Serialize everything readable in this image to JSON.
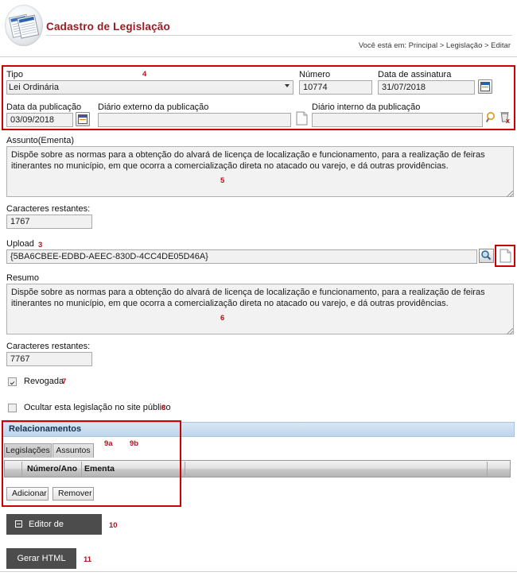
{
  "header": {
    "app_title": "Cadastro de Legislação",
    "breadcrumb": "Você está em: Principal > Legislação > Editar",
    "logo_icon": "document-stack-icon"
  },
  "form": {
    "tipo": {
      "label": "Tipo",
      "value": "Lei Ordinária",
      "annotation": "4"
    },
    "numero": {
      "label": "Número",
      "value": "10774"
    },
    "data_assinatura": {
      "label": "Data de assinatura",
      "value": "31/07/2018",
      "icon": "calendar-icon"
    },
    "data_publicacao": {
      "label": "Data da publicação",
      "value": "03/09/2018",
      "icon": "calendar-icon"
    },
    "diario_externo": {
      "label": "Diário externo da publicação",
      "value": "",
      "icon": "document-icon"
    },
    "diario_interno": {
      "label": "Diário interno da publicação",
      "value": "",
      "search_icon": "magnifier-icon",
      "clear_icon": "delete-trash-icon"
    }
  },
  "assunto": {
    "label": "Assunto(Ementa)",
    "value": "Dispõe sobre as normas para a obtenção do alvará de licença de localização e funcionamento, para a realização de feiras itinerantes no município, em que ocorra a comercialização direta no atacado ou varejo, e dá outras providências.",
    "annotation": "5",
    "counter_label": "Caracteres restantes:",
    "counter_value": "1767"
  },
  "upload": {
    "label": "Upload",
    "annotation": "3",
    "value": "{5BA6CBEE-EDBD-AEEC-830D-4CC4DE05D46A}",
    "search_icon": "magnifier-icon",
    "file_icon": "document-icon"
  },
  "resumo": {
    "label": "Resumo",
    "value": "Dispõe sobre as normas para a obtenção do alvará de licença de localização e funcionamento, para a realização de feiras itinerantes no município, em que ocorra a comercialização direta no atacado ou varejo, e dá outras providências.",
    "annotation": "6",
    "counter_label": "Caracteres restantes:",
    "counter_value": "7767"
  },
  "checkboxes": {
    "revogada": {
      "label": "Revogada",
      "checked": true,
      "annotation": "7"
    },
    "ocultar": {
      "label": "Ocultar esta legislação no site público",
      "checked": false,
      "annotation": "8"
    }
  },
  "relacionamentos": {
    "title": "Relacionamentos",
    "tabs": [
      {
        "label": "Legislações",
        "annotation": "9a",
        "active": true
      },
      {
        "label": "Assuntos",
        "annotation": "9b",
        "active": false
      }
    ],
    "columns": [
      "Número/Ano",
      "Ementa"
    ],
    "rows": [],
    "buttons": [
      {
        "label": "Adicionar"
      },
      {
        "label": "Remover"
      }
    ]
  },
  "footer": {
    "editor_button": {
      "label": "Editor de legislação",
      "annotation": "10",
      "icon": "collapse-box-icon"
    },
    "gerar_button": {
      "label": "Gerar HTML",
      "annotation": "11"
    }
  }
}
